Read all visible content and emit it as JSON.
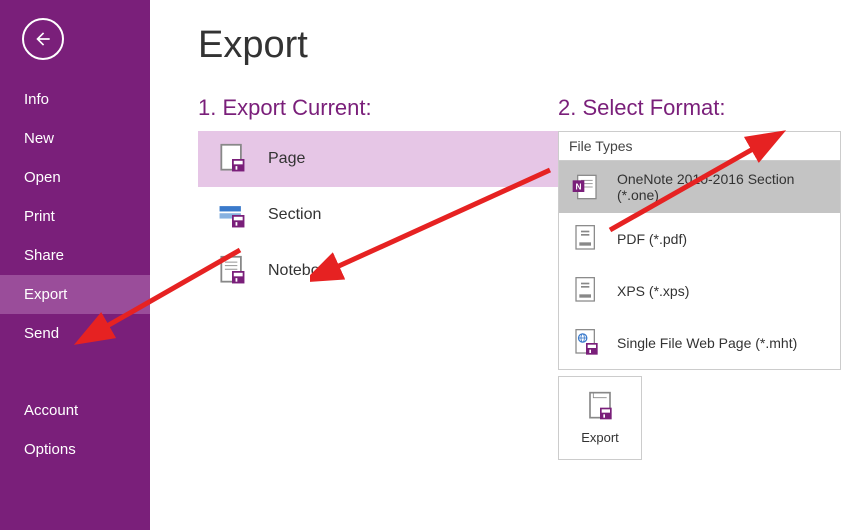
{
  "sidebar": {
    "items": [
      {
        "label": "Info"
      },
      {
        "label": "New"
      },
      {
        "label": "Open"
      },
      {
        "label": "Print"
      },
      {
        "label": "Share"
      },
      {
        "label": "Export",
        "selected": true
      },
      {
        "label": "Send"
      }
    ],
    "bottomItems": [
      {
        "label": "Account"
      },
      {
        "label": "Options"
      }
    ]
  },
  "page": {
    "title": "Export",
    "step1": {
      "heading": "1. Export Current:",
      "items": [
        {
          "label": "Page",
          "selected": true,
          "name": "export-item-page"
        },
        {
          "label": "Section",
          "selected": false,
          "name": "export-item-section"
        },
        {
          "label": "Notebook",
          "selected": false,
          "name": "export-item-notebook"
        }
      ]
    },
    "step2": {
      "heading": "2. Select Format:",
      "fileTypesHeader": "File Types",
      "fileTypes": [
        {
          "label": "OneNote 2010-2016 Section (*.one)",
          "selected": true,
          "name": "filetype-one"
        },
        {
          "label": "PDF (*.pdf)",
          "selected": false,
          "name": "filetype-pdf"
        },
        {
          "label": "XPS (*.xps)",
          "selected": false,
          "name": "filetype-xps"
        },
        {
          "label": "Single File Web Page (*.mht)",
          "selected": false,
          "name": "filetype-mht"
        }
      ],
      "exportButton": "Export"
    }
  }
}
